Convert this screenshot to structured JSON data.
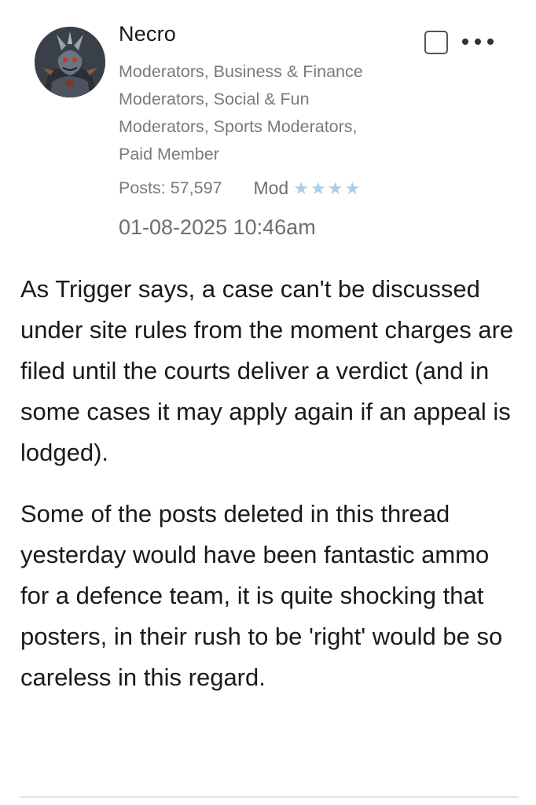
{
  "post": {
    "author": {
      "name": "Necro",
      "avatar_icon": "warrior-avatar",
      "roles": [
        "Moderators, Business & Finance",
        "Moderators, Social & Fun",
        "Moderators, Sports Moderators,",
        "Paid Member"
      ],
      "posts_count": "Posts: 57,597",
      "rank_label": "Mod",
      "rank_stars": 4,
      "star_color": "#a8cfe8"
    },
    "timestamp": "01-08-2025 10:46am",
    "actions": {
      "select_icon": "checkbox-icon",
      "more_icon": "more-options-icon"
    },
    "paragraphs": [
      "As Trigger says, a case can't be discussed under site rules from the moment charges are filed until the courts deliver a verdict (and in some cases it may apply again if an appeal is lodged).",
      "Some of the posts deleted in this thread yesterday would have been fantastic ammo for a defence team, it is quite shocking that posters, in their rush to be 'right' would be so careless in this regard."
    ]
  }
}
